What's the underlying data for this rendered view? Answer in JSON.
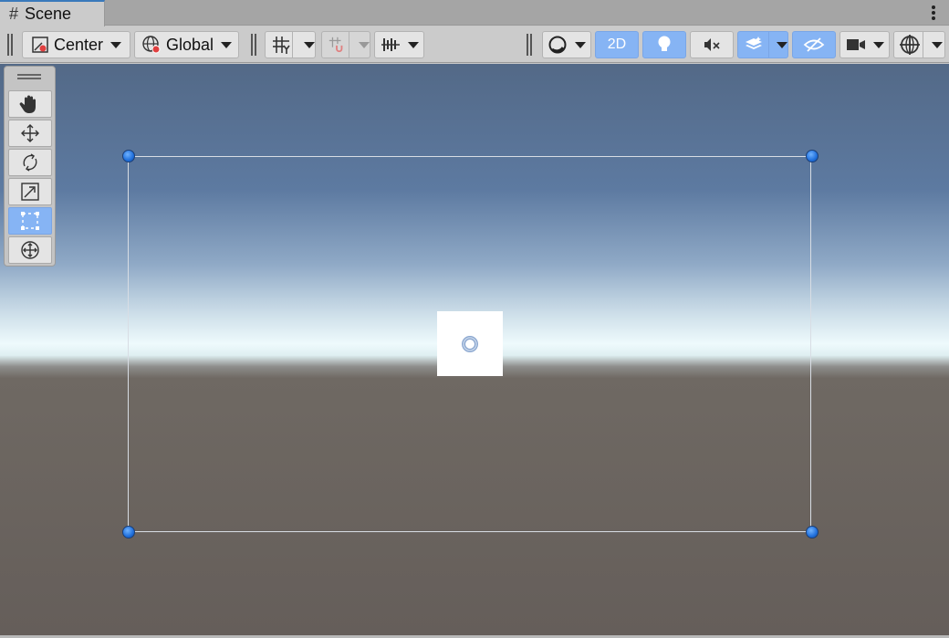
{
  "tab": {
    "title": "Scene",
    "icon": "grid-hash-icon"
  },
  "toolbar": {
    "pivot_mode": "Center",
    "pivot_icon": "pivot-center-icon",
    "space_mode": "Global",
    "space_icon": "globe-icon",
    "grid_snap_icon": "grid-snap-icon",
    "increment_snap_icon": "increment-snap-icon",
    "align_icon": "align-icon",
    "shading_icon": "shading-sphere-icon",
    "two_d_label": "2D",
    "lighting_icon": "light-bulb-icon",
    "audio_icon": "audio-mute-icon",
    "effects_icon": "effects-layers-icon",
    "visibility_icon": "hidden-eye-icon",
    "camera_icon": "camera-icon",
    "gizmos_icon": "gizmos-icon",
    "accent_color": "#86b4f4"
  },
  "tools": [
    {
      "name": "hand-tool",
      "icon": "hand-icon",
      "active": false
    },
    {
      "name": "move-tool",
      "icon": "move-arrows-icon",
      "active": false
    },
    {
      "name": "rotate-tool",
      "icon": "rotate-icon",
      "active": false
    },
    {
      "name": "scale-tool",
      "icon": "scale-icon",
      "active": false
    },
    {
      "name": "rect-tool",
      "icon": "rect-tool-icon",
      "active": true
    },
    {
      "name": "transform-tool",
      "icon": "transform-icon",
      "active": false
    }
  ],
  "scene": {
    "gizmo": "rect-transform",
    "handle_color": "#1f6fdc",
    "sprite_color": "#ffffff"
  }
}
